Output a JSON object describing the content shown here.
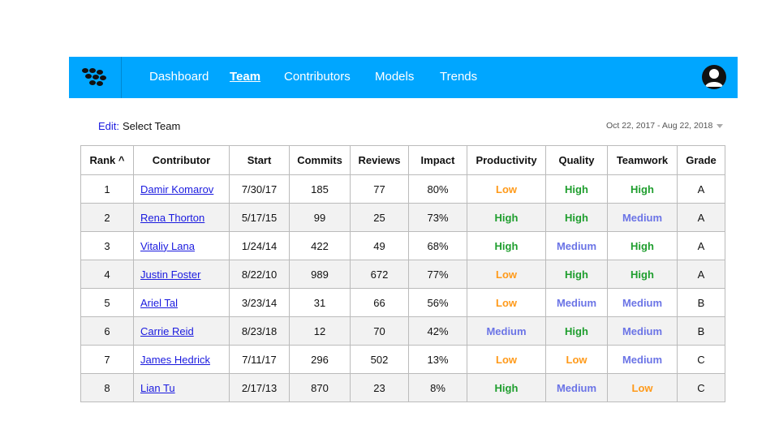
{
  "nav": {
    "items": [
      {
        "label": "Dashboard",
        "active": false
      },
      {
        "label": "Team",
        "active": true
      },
      {
        "label": "Contributors",
        "active": false
      },
      {
        "label": "Models",
        "active": false
      },
      {
        "label": "Trends",
        "active": false
      }
    ],
    "logo_icon": "brand-logo-icon",
    "avatar_icon": "user-avatar-icon",
    "color": "#00a6ff"
  },
  "toolbar": {
    "edit_label": "Edit:",
    "select_team_label": "Select Team",
    "date_range": "Oct 22, 2017 - Aug 22, 2018"
  },
  "table": {
    "headers": [
      "Rank ^",
      "Contributor",
      "Start",
      "Commits",
      "Reviews",
      "Impact",
      "Productivity",
      "Quality",
      "Teamwork",
      "Grade"
    ],
    "rows": [
      {
        "rank": "1",
        "contributor": "Damir Komarov",
        "start": "7/30/17",
        "commits": "185",
        "reviews": "77",
        "impact": "80%",
        "productivity": "Low",
        "quality": "High",
        "teamwork": "High",
        "grade": "A"
      },
      {
        "rank": "2",
        "contributor": "Rena Thorton",
        "start": "5/17/15",
        "commits": "99",
        "reviews": "25",
        "impact": "73%",
        "productivity": "High",
        "quality": "High",
        "teamwork": "Medium",
        "grade": "A"
      },
      {
        "rank": "3",
        "contributor": "Vitaliy Lana",
        "start": "1/24/14",
        "commits": "422",
        "reviews": "49",
        "impact": "68%",
        "productivity": "High",
        "quality": "Medium",
        "teamwork": "High",
        "grade": "A"
      },
      {
        "rank": "4",
        "contributor": "Justin Foster",
        "start": "8/22/10",
        "commits": "989",
        "reviews": "672",
        "impact": "77%",
        "productivity": "Low",
        "quality": "High",
        "teamwork": "High",
        "grade": "A"
      },
      {
        "rank": "5",
        "contributor": "Ariel Tal",
        "start": "3/23/14",
        "commits": "31",
        "reviews": "66",
        "impact": "56%",
        "productivity": "Low",
        "quality": "Medium",
        "teamwork": "Medium",
        "grade": "B"
      },
      {
        "rank": "6",
        "contributor": "Carrie Reid",
        "start": "8/23/18",
        "commits": "12",
        "reviews": "70",
        "impact": "42%",
        "productivity": "Medium",
        "quality": "High",
        "teamwork": "Medium",
        "grade": "B"
      },
      {
        "rank": "7",
        "contributor": "James Hedrick",
        "start": "7/11/17",
        "commits": "296",
        "reviews": "502",
        "impact": "13%",
        "productivity": "Low",
        "quality": "Low",
        "teamwork": "Medium",
        "grade": "C"
      },
      {
        "rank": "8",
        "contributor": "Lian Tu",
        "start": "2/17/13",
        "commits": "870",
        "reviews": "23",
        "impact": "8%",
        "productivity": "High",
        "quality": "Medium",
        "teamwork": "Low",
        "grade": "C"
      }
    ]
  },
  "colors": {
    "high": "#1f9e2e",
    "medium": "#6b74e6",
    "low": "#ff9a1a",
    "link": "#1a1adf"
  }
}
